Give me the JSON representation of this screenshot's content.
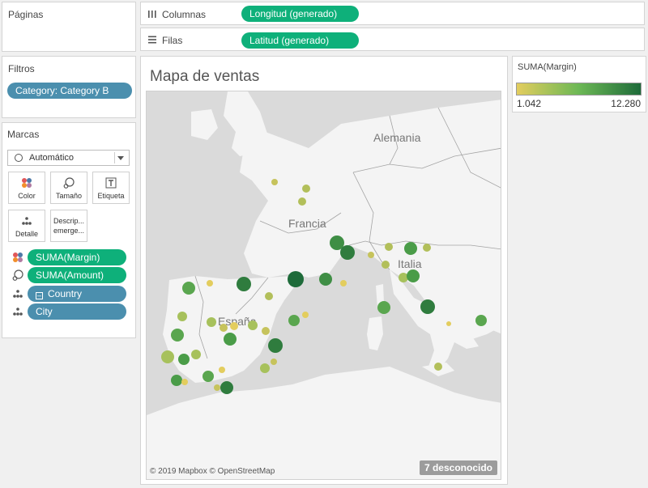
{
  "pages": {
    "title": "Páginas"
  },
  "shelves": {
    "columns": {
      "label": "Columnas",
      "pill": "Longitud (generado)"
    },
    "rows": {
      "label": "Filas",
      "pill": "Latitud (generado)"
    }
  },
  "filters": {
    "title": "Filtros",
    "pill": "Category: Category B"
  },
  "marks": {
    "title": "Marcas",
    "type_value": "Automático",
    "buttons": {
      "color": "Color",
      "size": "Tamaño",
      "label": "Etiqueta",
      "detail": "Detalle",
      "tooltip_l1": "Descrip...",
      "tooltip_l2": "emerge..."
    },
    "pills": [
      "SUMA(Margin)",
      "SUMA(Amount)",
      "Country",
      "City"
    ]
  },
  "view": {
    "title": "Mapa de ventas",
    "countries": {
      "germany": "Alemania",
      "france": "Francia",
      "italy": "Italia",
      "spain": "España"
    },
    "attribution": "© 2019 Mapbox © OpenStreetMap",
    "unknown_badge": "7 desconocido"
  },
  "legend": {
    "title": "SUMA(Margin)",
    "min": "1.042",
    "max": "12.280",
    "colors": [
      "#e3cd5e",
      "#6cb855",
      "#1e6b3a"
    ]
  }
}
